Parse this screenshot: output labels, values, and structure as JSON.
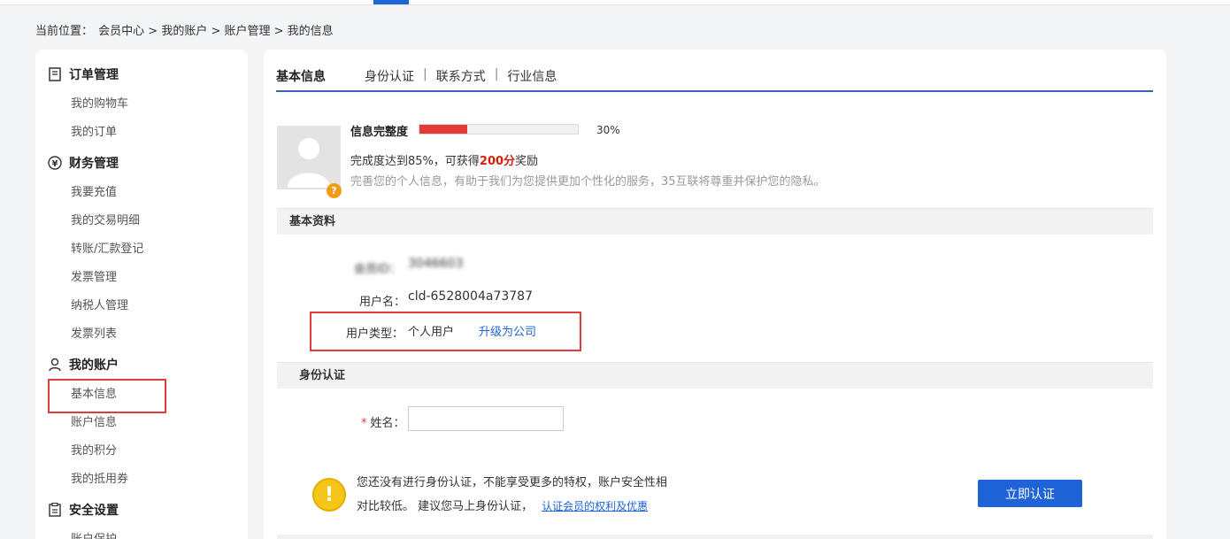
{
  "breadcrumb": {
    "label": "当前位置：",
    "path": "会员中心 > 我的账户 > 账户管理 > 我的信息"
  },
  "sidebar": {
    "groups": [
      {
        "title": "订单管理",
        "icon": "document-icon",
        "items": [
          "我的购物车",
          "我的订单"
        ]
      },
      {
        "title": "财务管理",
        "icon": "yen-coin-icon",
        "items": [
          "我要充值",
          "我的交易明细",
          "转账/汇款登记",
          "发票管理",
          "纳税人管理",
          "发票列表"
        ]
      },
      {
        "title": "我的账户",
        "icon": "user-icon",
        "items": [
          "基本信息",
          "账户信息",
          "我的积分",
          "我的抵用券"
        ]
      },
      {
        "title": "安全设置",
        "icon": "clipboard-icon",
        "items": [
          "账户保护"
        ]
      }
    ]
  },
  "tabs": {
    "active": "基本信息",
    "others": [
      "身份认证",
      "联系方式",
      "行业信息"
    ],
    "separator": "|"
  },
  "profile": {
    "completeness_label": "信息完整度",
    "progress": 30,
    "progress_text": "30%",
    "reward_prefix": "完成度达到85%，可获得",
    "reward_points": "200分",
    "reward_suffix": "奖励",
    "hint": "完善您的个人信息，有助于我们为您提供更加个性化的服务，35互联将尊重并保护您的隐私。"
  },
  "basic_info": {
    "section_title": "基本资料",
    "member_id_label": "会员ID：",
    "member_id_value": "3046603",
    "username_label": "用户名：",
    "username_value": "cld-6528004a73787",
    "user_type_label": "用户类型：",
    "user_type_value": "个人用户",
    "upgrade_link": "升级为公司"
  },
  "identity": {
    "section_title": "身份认证",
    "required_mark": "*",
    "name_label": "姓名：",
    "name_value": "",
    "warning_line1": "您还没有进行身份认证，不能享受更多的特权，账户安全性相",
    "warning_line2": "对比较低。 建议您马上身份认证，",
    "warning_link": "认证会员的权利及优惠",
    "verify_button": "立即认证"
  },
  "colors": {
    "accent": "#1f63d8",
    "highlight": "#e03c3c",
    "progress": "#e53935",
    "points": "#d81e06"
  }
}
